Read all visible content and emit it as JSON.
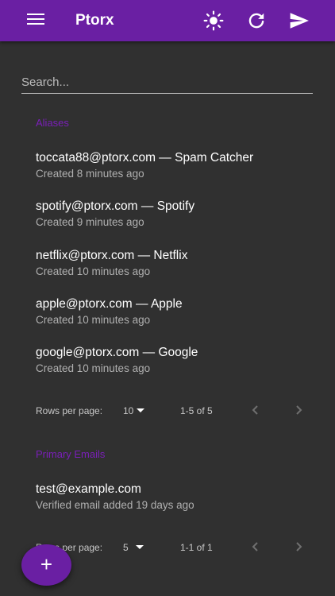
{
  "app": {
    "title": "Ptorx"
  },
  "search": {
    "placeholder": "Search..."
  },
  "aliases": {
    "title": "Aliases",
    "items": [
      {
        "address": "toccata88@ptorx.com — Spam Catcher",
        "created": "Created 8 minutes ago"
      },
      {
        "address": "spotify@ptorx.com — Spotify",
        "created": "Created 9 minutes ago"
      },
      {
        "address": "netflix@ptorx.com — Netflix",
        "created": "Created 10 minutes ago"
      },
      {
        "address": "apple@ptorx.com — Apple",
        "created": "Created 10 minutes ago"
      },
      {
        "address": "google@ptorx.com — Google",
        "created": "Created 10 minutes ago"
      }
    ],
    "pagination": {
      "rows_label": "Rows per page:",
      "rows_value": "10",
      "range": "1-5 of 5"
    }
  },
  "primary_emails": {
    "title": "Primary Emails",
    "items": [
      {
        "address": "test@example.com",
        "created": "Verified email added 19 days ago"
      }
    ],
    "pagination": {
      "rows_label": "Rows per page:",
      "rows_value": "5",
      "range": "1-1 of 1"
    }
  },
  "fab": {
    "label": "+"
  },
  "colors": {
    "accent": "#6a1fa3",
    "section_title": "#7a1fb8",
    "background": "#303030"
  },
  "icons": [
    "menu-icon",
    "brightness-icon",
    "refresh-icon",
    "send-icon",
    "chevron-left-icon",
    "chevron-right-icon",
    "add-icon"
  ]
}
